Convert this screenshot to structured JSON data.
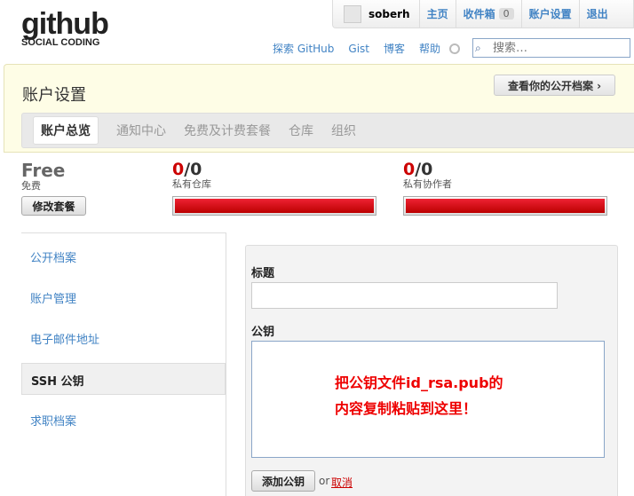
{
  "logo": {
    "word": "github",
    "tagline": "SOCIAL CODING"
  },
  "userbar": {
    "username": "soberh",
    "links": {
      "home": "主页",
      "inbox": "收件箱",
      "settings": "账户设置",
      "logout": "退出"
    },
    "inbox_count": "0"
  },
  "topnav": {
    "explore": "探索 GitHub",
    "gist": "Gist",
    "blog": "博客",
    "help": "帮助"
  },
  "search": {
    "placeholder": "搜索…"
  },
  "settings": {
    "title": "账户设置",
    "public_profile_button": "查看你的公开档案 ›",
    "tabs": [
      "账户总览",
      "通知中心",
      "免费及计费套餐",
      "仓库",
      "组织"
    ]
  },
  "stats": {
    "plan": {
      "name": "Free",
      "label": "免费",
      "change_button": "修改套餐"
    },
    "private_repos": {
      "used": "0",
      "total": "/0",
      "label": "私有仓库",
      "fill": 1.0
    },
    "collaborators": {
      "used": "0",
      "total": "/0",
      "label": "私有协作者",
      "fill": 1.0
    }
  },
  "sidebar": {
    "items": [
      "公开档案",
      "账户管理",
      "电子邮件地址",
      "SSH 公钥",
      "求职档案"
    ],
    "active_index": 3
  },
  "form": {
    "title_label": "标题",
    "title_value": "",
    "key_label": "公钥",
    "annotation_line1": "把公钥文件id_rsa.pub的",
    "annotation_line2": "内容复制粘贴到这里！",
    "add_button": "添加公钥",
    "or": "or",
    "cancel": "取消"
  },
  "colors": {
    "link": "#4183c4",
    "danger": "#cc0000",
    "panel": "#fefde6"
  }
}
